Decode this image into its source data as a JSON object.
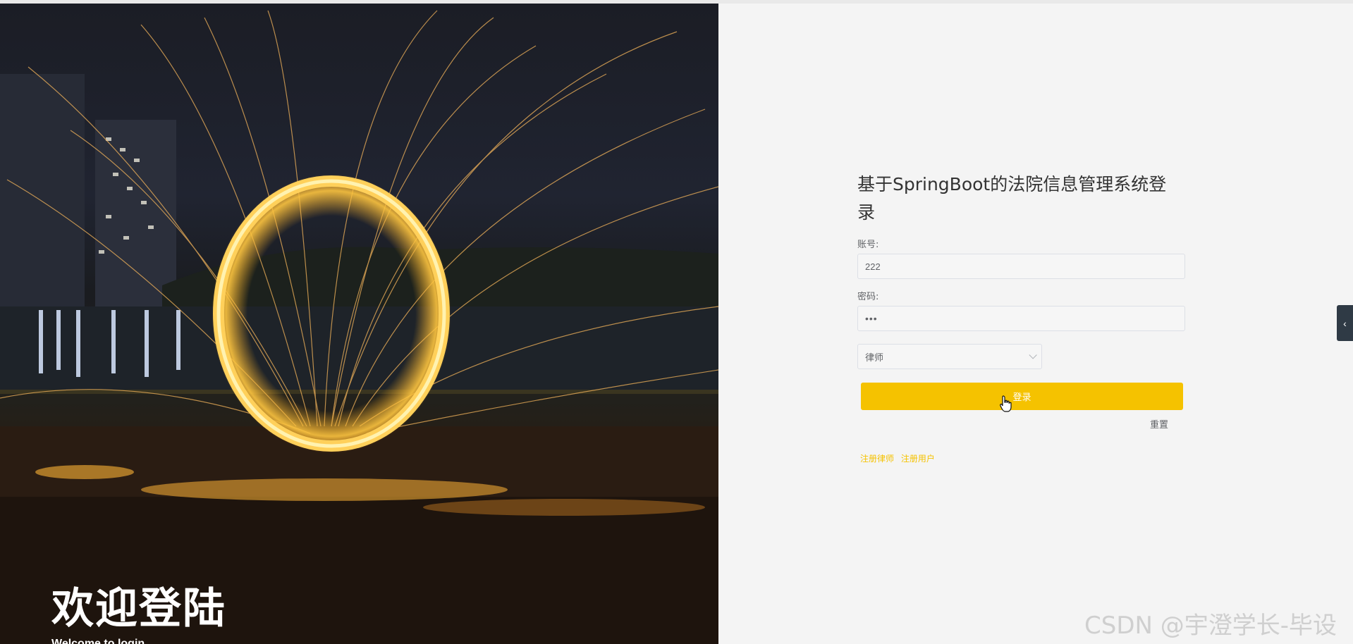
{
  "hero": {
    "title": "欢迎登陆",
    "subtitle": "Welcome to login"
  },
  "login": {
    "title": "基于SpringBoot的法院信息管理系统登录",
    "account_label": "账号:",
    "account_value": "222",
    "password_label": "密码:",
    "password_value": "•••",
    "role_selected": "律师",
    "login_button": "登录",
    "reset_button": "重置",
    "register_lawyer": "注册律师",
    "register_user": "注册用户"
  },
  "side_tab": {
    "icon": "chevron-left-icon",
    "glyph": "‹"
  },
  "watermark": "CSDN @宇澄学长-毕设",
  "colors": {
    "accent": "#f5c200",
    "background": "#f4f4f4"
  }
}
